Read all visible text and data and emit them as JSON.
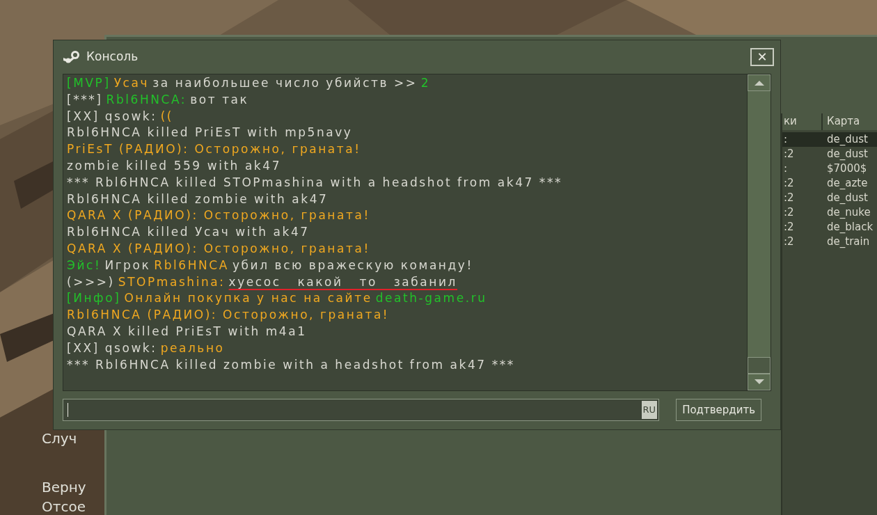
{
  "background_menu": [
    "Случ",
    "Верну",
    "Отсое"
  ],
  "server_list": {
    "columns": [
      "ки",
      "Карта"
    ],
    "rows": [
      {
        "column_1": ":",
        "map": "de_dust",
        "selected": true
      },
      {
        "column_1": ":2",
        "map": "de_dust",
        "selected": false
      },
      {
        "column_1": ":",
        "map": "$7000$",
        "selected": false
      },
      {
        "column_1": ":2",
        "map": "de_azte",
        "selected": false
      },
      {
        "column_1": ":2",
        "map": "de_dust",
        "selected": false
      },
      {
        "column_1": ":2",
        "map": "de_nuke",
        "selected": false
      },
      {
        "column_1": ":2",
        "map": "de_black",
        "selected": false
      },
      {
        "column_1": ":2",
        "map": "de_train",
        "selected": false
      }
    ]
  },
  "window": {
    "title": "Консоль",
    "close": "✕"
  },
  "log": [
    [
      {
        "text": "[MVP]",
        "color": "#22c02a"
      },
      {
        "text": "Усач",
        "color": "#f0a820"
      },
      {
        "text": "за наибольшее число убийств >>",
        "color": "#d8d8d0"
      },
      {
        "text": "2",
        "color": "#22c02a"
      }
    ],
    [
      {
        "text": "[***]",
        "color": "#d8d8d0"
      },
      {
        "text": "Rbl6HNCA:",
        "color": "#22c02a"
      },
      {
        "text": "вот так",
        "color": "#d8d8d0"
      }
    ],
    [
      {
        "text": "[XX] qsowk:",
        "color": "#d8d8d0"
      },
      {
        "text": "((",
        "color": "#f0a820"
      }
    ],
    [
      {
        "text": "Rbl6HNCA killed PriEsT with mp5navy",
        "color": "#d8d8d0"
      }
    ],
    [
      {
        "text": "PriEsT (РАДИО): Осторожно, граната!",
        "color": "#f0a820"
      }
    ],
    [
      {
        "text": "zombie killed 559 with ak47",
        "color": "#d8d8d0"
      }
    ],
    [
      {
        "text": "*** Rbl6HNCA killed STOPmashina with a headshot from ak47 ***",
        "color": "#d8d8d0"
      }
    ],
    [
      {
        "text": "Rbl6HNCA killed zombie with ak47",
        "color": "#d8d8d0"
      }
    ],
    [
      {
        "text": "QARA X (РАДИО): Осторожно, граната!",
        "color": "#f0a820"
      }
    ],
    [
      {
        "text": "Rbl6HNCA killed Усач with ak47",
        "color": "#d8d8d0"
      }
    ],
    [
      {
        "text": "QARA X (РАДИО): Осторожно, граната!",
        "color": "#f0a820"
      }
    ],
    [
      {
        "text": "Эйс!",
        "color": "#22c02a"
      },
      {
        "text": "Игрок",
        "color": "#d8d8d0"
      },
      {
        "text": "Rbl6HNCA",
        "color": "#f0a820"
      },
      {
        "text": "убил всю вражескую команду!",
        "color": "#d8d8d0"
      }
    ],
    [
      {
        "text": "(>>>)",
        "color": "#d8d8d0"
      },
      {
        "text": "STOPmashina:",
        "color": "#f0a820"
      },
      {
        "text": "хуесос   какой   то   забанил",
        "color": "#d8d8d0",
        "marked": true
      }
    ],
    [
      {
        "text": "[Инфо]",
        "color": "#22c02a"
      },
      {
        "text": "Онлайн покупка у нас на сайте",
        "color": "#f0a820"
      },
      {
        "text": "death-game.ru",
        "color": "#22c02a"
      }
    ],
    [
      {
        "text": "Rbl6HNCA (РАДИО): Осторожно, граната!",
        "color": "#f0a820"
      }
    ],
    [
      {
        "text": "QARA X killed PriEsT with m4a1",
        "color": "#d8d8d0"
      }
    ],
    [
      {
        "text": "[XX] qsowk:",
        "color": "#d8d8d0"
      },
      {
        "text": "реально",
        "color": "#f0a820"
      }
    ],
    [
      {
        "text": "*** Rbl6HNCA killed zombie with a headshot from ak47 ***",
        "color": "#d8d8d0"
      }
    ]
  ],
  "input": {
    "language": "RU"
  },
  "submit_button": "Подтвердить"
}
